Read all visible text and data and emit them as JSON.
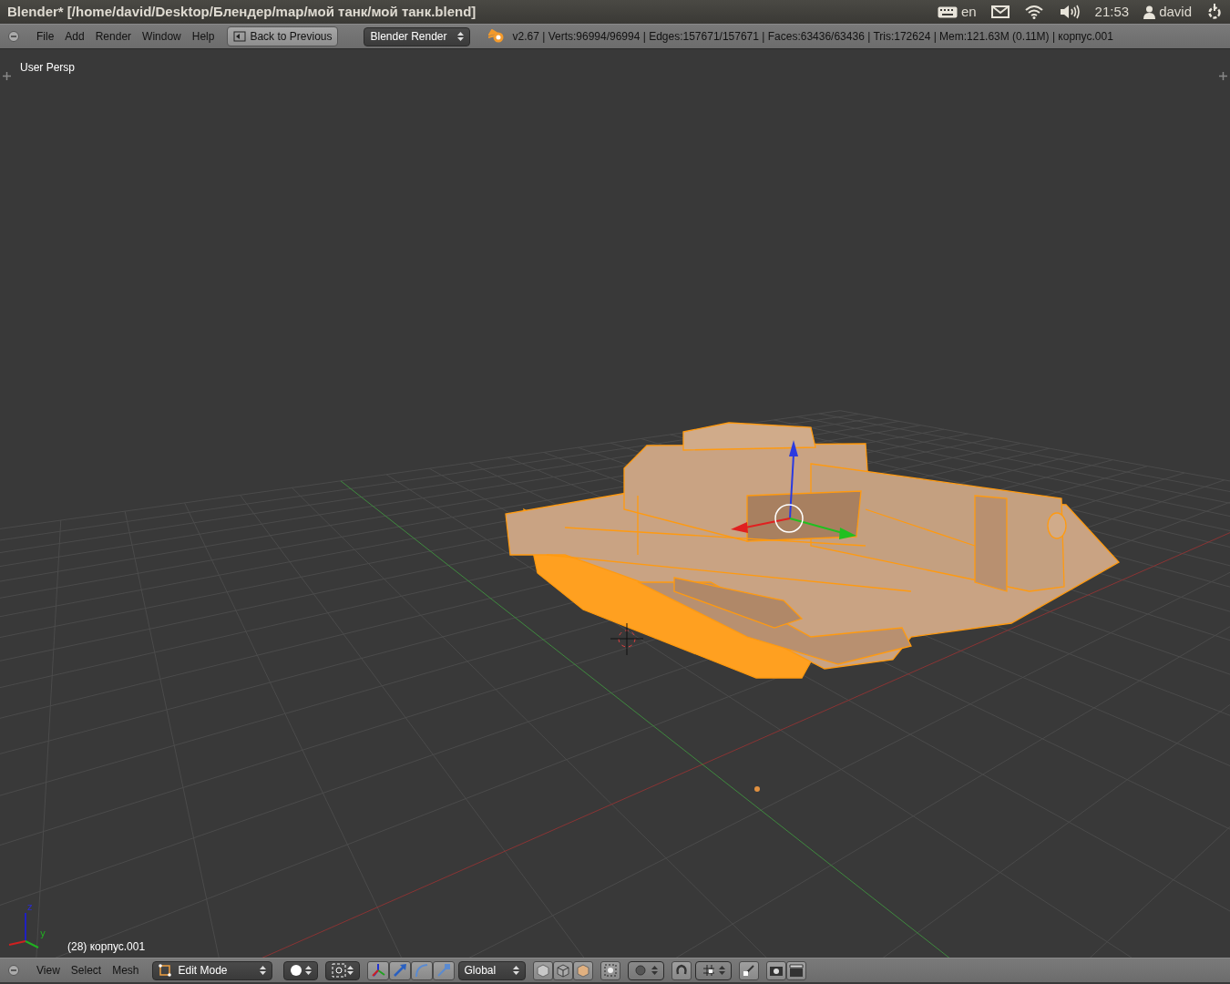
{
  "window": {
    "title": "Blender* [/home/david/Desktop/Блендер/map/мой танк/мой танк.blend]"
  },
  "system_tray": {
    "keyboard_layout": "en",
    "time": "21:53",
    "user": "david"
  },
  "info_header": {
    "menus": [
      "File",
      "Add",
      "Render",
      "Window",
      "Help"
    ],
    "back_button": "Back to Previous",
    "render_engine": "Blender Render",
    "stats": "v2.67 | Verts:96994/96994 | Edges:157671/157671 | Faces:63436/63436 | Tris:172624 | Mem:121.63M (0.11M) | корпус.001"
  },
  "viewport": {
    "view_label": "User Persp",
    "object_info": "(28) корпус.001",
    "axis_labels": [
      "z",
      "y"
    ]
  },
  "view3d_header": {
    "menus": [
      "View",
      "Select",
      "Mesh"
    ],
    "mode": "Edit Mode",
    "orientation": "Global"
  }
}
